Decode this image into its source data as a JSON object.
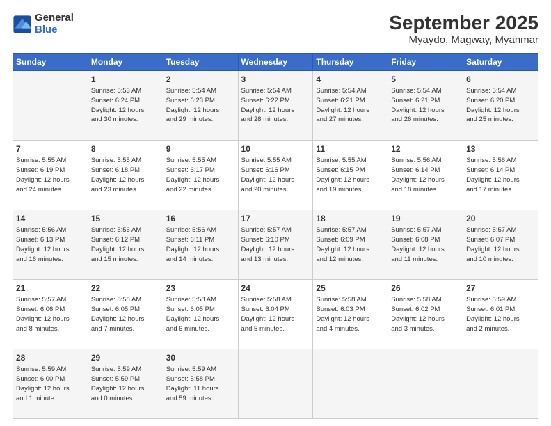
{
  "header": {
    "title": "September 2025",
    "subtitle": "Myaydo, Magway, Myanmar",
    "logo_line1": "General",
    "logo_line2": "Blue"
  },
  "columns": [
    "Sunday",
    "Monday",
    "Tuesday",
    "Wednesday",
    "Thursday",
    "Friday",
    "Saturday"
  ],
  "weeks": [
    [
      {
        "day": "",
        "info": ""
      },
      {
        "day": "1",
        "info": "Sunrise: 5:53 AM\nSunset: 6:24 PM\nDaylight: 12 hours\nand 30 minutes."
      },
      {
        "day": "2",
        "info": "Sunrise: 5:54 AM\nSunset: 6:23 PM\nDaylight: 12 hours\nand 29 minutes."
      },
      {
        "day": "3",
        "info": "Sunrise: 5:54 AM\nSunset: 6:22 PM\nDaylight: 12 hours\nand 28 minutes."
      },
      {
        "day": "4",
        "info": "Sunrise: 5:54 AM\nSunset: 6:21 PM\nDaylight: 12 hours\nand 27 minutes."
      },
      {
        "day": "5",
        "info": "Sunrise: 5:54 AM\nSunset: 6:21 PM\nDaylight: 12 hours\nand 26 minutes."
      },
      {
        "day": "6",
        "info": "Sunrise: 5:54 AM\nSunset: 6:20 PM\nDaylight: 12 hours\nand 25 minutes."
      }
    ],
    [
      {
        "day": "7",
        "info": "Sunrise: 5:55 AM\nSunset: 6:19 PM\nDaylight: 12 hours\nand 24 minutes."
      },
      {
        "day": "8",
        "info": "Sunrise: 5:55 AM\nSunset: 6:18 PM\nDaylight: 12 hours\nand 23 minutes."
      },
      {
        "day": "9",
        "info": "Sunrise: 5:55 AM\nSunset: 6:17 PM\nDaylight: 12 hours\nand 22 minutes."
      },
      {
        "day": "10",
        "info": "Sunrise: 5:55 AM\nSunset: 6:16 PM\nDaylight: 12 hours\nand 20 minutes."
      },
      {
        "day": "11",
        "info": "Sunrise: 5:55 AM\nSunset: 6:15 PM\nDaylight: 12 hours\nand 19 minutes."
      },
      {
        "day": "12",
        "info": "Sunrise: 5:56 AM\nSunset: 6:14 PM\nDaylight: 12 hours\nand 18 minutes."
      },
      {
        "day": "13",
        "info": "Sunrise: 5:56 AM\nSunset: 6:14 PM\nDaylight: 12 hours\nand 17 minutes."
      }
    ],
    [
      {
        "day": "14",
        "info": "Sunrise: 5:56 AM\nSunset: 6:13 PM\nDaylight: 12 hours\nand 16 minutes."
      },
      {
        "day": "15",
        "info": "Sunrise: 5:56 AM\nSunset: 6:12 PM\nDaylight: 12 hours\nand 15 minutes."
      },
      {
        "day": "16",
        "info": "Sunrise: 5:56 AM\nSunset: 6:11 PM\nDaylight: 12 hours\nand 14 minutes."
      },
      {
        "day": "17",
        "info": "Sunrise: 5:57 AM\nSunset: 6:10 PM\nDaylight: 12 hours\nand 13 minutes."
      },
      {
        "day": "18",
        "info": "Sunrise: 5:57 AM\nSunset: 6:09 PM\nDaylight: 12 hours\nand 12 minutes."
      },
      {
        "day": "19",
        "info": "Sunrise: 5:57 AM\nSunset: 6:08 PM\nDaylight: 12 hours\nand 11 minutes."
      },
      {
        "day": "20",
        "info": "Sunrise: 5:57 AM\nSunset: 6:07 PM\nDaylight: 12 hours\nand 10 minutes."
      }
    ],
    [
      {
        "day": "21",
        "info": "Sunrise: 5:57 AM\nSunset: 6:06 PM\nDaylight: 12 hours\nand 8 minutes."
      },
      {
        "day": "22",
        "info": "Sunrise: 5:58 AM\nSunset: 6:05 PM\nDaylight: 12 hours\nand 7 minutes."
      },
      {
        "day": "23",
        "info": "Sunrise: 5:58 AM\nSunset: 6:05 PM\nDaylight: 12 hours\nand 6 minutes."
      },
      {
        "day": "24",
        "info": "Sunrise: 5:58 AM\nSunset: 6:04 PM\nDaylight: 12 hours\nand 5 minutes."
      },
      {
        "day": "25",
        "info": "Sunrise: 5:58 AM\nSunset: 6:03 PM\nDaylight: 12 hours\nand 4 minutes."
      },
      {
        "day": "26",
        "info": "Sunrise: 5:58 AM\nSunset: 6:02 PM\nDaylight: 12 hours\nand 3 minutes."
      },
      {
        "day": "27",
        "info": "Sunrise: 5:59 AM\nSunset: 6:01 PM\nDaylight: 12 hours\nand 2 minutes."
      }
    ],
    [
      {
        "day": "28",
        "info": "Sunrise: 5:59 AM\nSunset: 6:00 PM\nDaylight: 12 hours\nand 1 minute."
      },
      {
        "day": "29",
        "info": "Sunrise: 5:59 AM\nSunset: 5:59 PM\nDaylight: 12 hours\nand 0 minutes."
      },
      {
        "day": "30",
        "info": "Sunrise: 5:59 AM\nSunset: 5:58 PM\nDaylight: 11 hours\nand 59 minutes."
      },
      {
        "day": "",
        "info": ""
      },
      {
        "day": "",
        "info": ""
      },
      {
        "day": "",
        "info": ""
      },
      {
        "day": "",
        "info": ""
      }
    ]
  ]
}
